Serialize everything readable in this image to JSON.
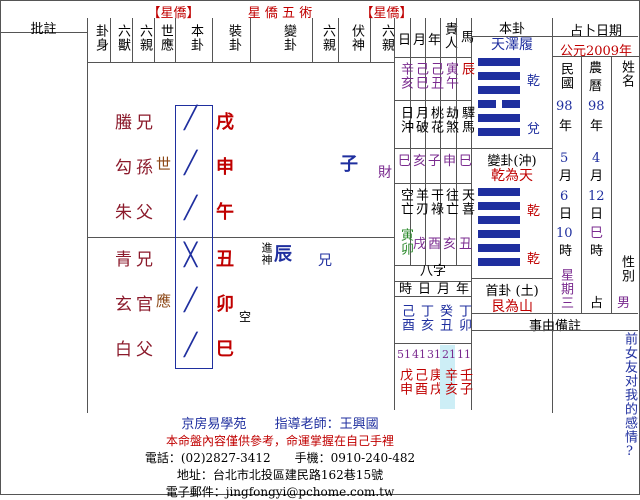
{
  "banner": {
    "left": "【星僑】",
    "center": "星 僑 五 術",
    "right": "【星僑】"
  },
  "left_note": {
    "label": "批註"
  },
  "headers": [
    "卦身",
    "六獸",
    "六親",
    "世應",
    "本卦",
    "裝卦",
    "變卦",
    "六親",
    "伏神",
    "六親"
  ],
  "header_date": [
    "日",
    "月",
    "年"
  ],
  "header_noble": "貴人",
  "header_horse": "馬",
  "gua": {
    "title": "本卦",
    "name": "天澤履",
    "top": "乾",
    "bottom": "兌"
  },
  "change_gua": {
    "title": "變卦(沖)",
    "name": "乾為天",
    "top": "乾",
    "bottom": "乾"
  },
  "first_gua": {
    "title": "首卦 (土)",
    "name": "艮為山"
  },
  "divine": {
    "title": "占卜日期",
    "year": "公元2009年",
    "min": "民國",
    "nong": "農",
    "li": "曆",
    "xing_ming": "姓名",
    "min_year": "98",
    "nong_year": "98",
    "nian1": "年",
    "nian2": "年",
    "m1": "5",
    "m2": "4",
    "yue1": "月",
    "yue2": "月",
    "d1": "6",
    "d2": "12",
    "ri1": "日",
    "ri2": "日",
    "h1": "10",
    "h2": "巳",
    "shi1": "時",
    "shi2": "時",
    "star": "星期三",
    "zhan": "占",
    "gender_label": "性別",
    "gender": "男"
  },
  "events": {
    "title": "事由備註",
    "text": "前女友对我的感情?"
  },
  "rows": [
    {
      "beast": "螣",
      "rel": "兄",
      "shi": "",
      "yao": "yang",
      "gan": "戌"
    },
    {
      "beast": "勾",
      "rel": "孫",
      "shi": "世",
      "yao": "yang",
      "gan": "申"
    },
    {
      "beast": "朱",
      "rel": "父",
      "shi": "",
      "yao": "yang",
      "gan": "午"
    },
    {
      "beast": "青",
      "rel": "兄",
      "shi": "",
      "yao": "moving",
      "gan": "丑"
    },
    {
      "beast": "玄",
      "rel": "官",
      "shi": "應",
      "yao": "yang",
      "gan": "卯"
    },
    {
      "beast": "白",
      "rel": "父",
      "shi": "",
      "yao": "yang",
      "gan": "巳"
    }
  ],
  "fu_zi": "子",
  "fu_cai": "財",
  "bian_jin": "進神",
  "bian_chen": "辰",
  "bian_xiong": "兄",
  "kong": "空",
  "date_grid": {
    "row1": [
      "辛亥",
      "己巳",
      "己丑",
      "寅午",
      "辰"
    ],
    "row2_label": [
      "日沖",
      "月破",
      "桃花",
      "劫煞",
      "驛馬"
    ],
    "row2": [
      "巳",
      "亥",
      "子",
      "申",
      "巳"
    ],
    "row3_label": [
      "空亡",
      "羊刃",
      "干祿",
      "往亡",
      "天喜"
    ],
    "row3a": [
      "寅卯",
      "戌",
      "酉",
      "亥",
      "丑"
    ]
  },
  "bazi": {
    "title": "八字",
    "labels": [
      "時",
      "日",
      "月",
      "年"
    ],
    "values": [
      "己酉",
      "丁亥",
      "癸丑",
      "丁卯"
    ]
  },
  "dayun": [
    {
      "n": "51",
      "gz": "戊申"
    },
    {
      "n": "41",
      "gz": "己酉"
    },
    {
      "n": "31",
      "gz": "庚戌"
    },
    {
      "n": "21",
      "gz": "辛亥"
    },
    {
      "n": "11",
      "gz": "壬子"
    }
  ],
  "footer": {
    "school": "京房易學苑",
    "teacher": "指導老師：王興國",
    "note": "本命盤內容僅供參考，命運掌握在自己手裡",
    "phone": "電話：(02)2827-3412　　手機：0910-240-482",
    "addr": "地址：台北市北投區建民路162巷15號",
    "email": "電子郵件：jingfongyi@pchome.com.tw"
  }
}
